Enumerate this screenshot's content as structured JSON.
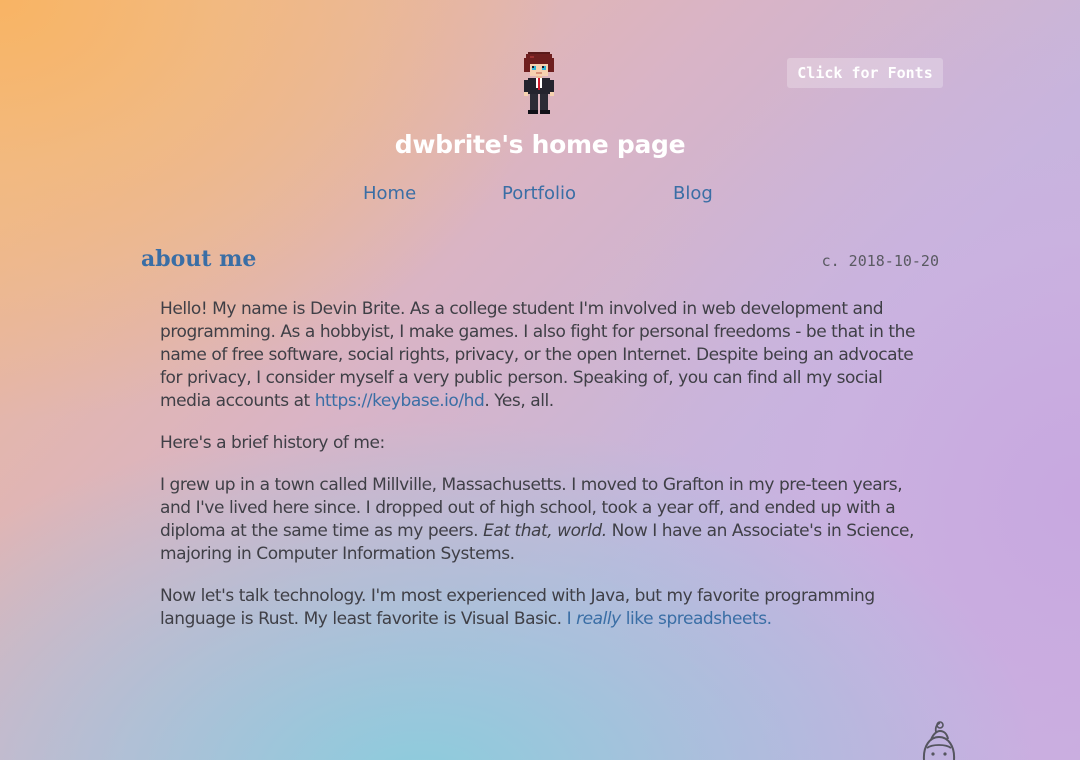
{
  "header": {
    "font_button": "Click for Fonts",
    "site_title": "dwbrite's home page"
  },
  "nav": {
    "items": [
      {
        "label": "Home"
      },
      {
        "label": "Portfolio"
      },
      {
        "label": "Blog"
      }
    ]
  },
  "post": {
    "heading": "about me",
    "date": "c. 2018-10-20",
    "p1_text": "Hello! My name is Devin Brite. As a college student I'm involved in web development and programming. As a hobbyist, I make games. I also fight for personal freedoms - be that in the name of free software, social rights, privacy, or the open Internet. Despite being an advocate for privacy, I consider myself a very public person. Speaking of, you can find all my social media accounts at ",
    "p1_link": "https://keybase.io/hd",
    "p1_tail": ". Yes, all.",
    "p2_text": "Here's a brief history of me:",
    "p3_text": "I grew up in a town called Millville, Massachusetts. I moved to Grafton in my pre-teen years, and I've lived here since. I dropped out of high school, took a year off, and ended up with a diploma at the same time as my peers. ",
    "p3_em": "Eat that, world.",
    "p3_tail": " Now I have an Associate's in Science, majoring in Computer Information Systems.",
    "p4_text": "Now let's talk technology. I'm most experienced with Java, but my favorite programming language is Rust. My least favorite is Visual Basic. ",
    "p4_link_pre": "I ",
    "p4_link_em": "really",
    "p4_link_post": " like spreadsheets."
  },
  "icons": {
    "avatar": "pixel-avatar-icon",
    "corner": "cartoon-character-icon"
  },
  "colors": {
    "link": "#3a6ea5",
    "title": "#ffffff",
    "text": "#3f3f46"
  }
}
